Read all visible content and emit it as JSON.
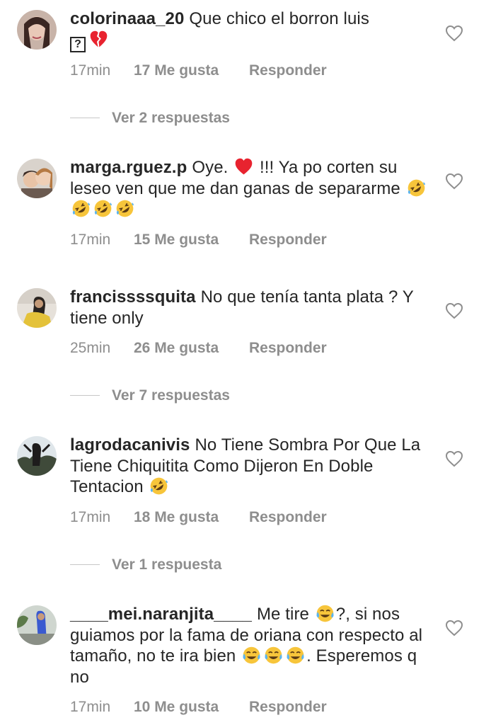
{
  "comments": [
    {
      "username": "colorinaaa_20",
      "text_parts": [
        "Que chico el borron luis",
        "?"
      ],
      "time": "17min",
      "likes": "17 Me gusta",
      "reply": "Responder",
      "replies": "Ver 2 respuestas"
    },
    {
      "username": "marga.rguez.p",
      "text_parts": [
        "Oye. ",
        " !!! Ya po corten su leseo ven que me dan ganas de separarme "
      ],
      "time": "17min",
      "likes": "15 Me gusta",
      "reply": "Responder"
    },
    {
      "username": "francissssquita",
      "text_parts": [
        "No que tenía tanta plata ? Y tiene only"
      ],
      "time": "25min",
      "likes": "26 Me gusta",
      "reply": "Responder",
      "replies": "Ver 7 respuestas"
    },
    {
      "username": "lagrodacanivis",
      "text_parts": [
        "No Tiene Sombra Por Que La Tiene Chiquitita Como Dijeron En Doble Tentacion "
      ],
      "time": "17min",
      "likes": "18 Me gusta",
      "reply": "Responder",
      "replies": "Ver 1 respuesta"
    },
    {
      "username": "____mei.naranjita____",
      "text_parts": [
        "Me tire ",
        "?, si nos guiamos por la fama de oriana con respecto  al tamaño, no te ira bien ",
        ". Esperemos q no"
      ],
      "time": "17min",
      "likes": "10 Me gusta",
      "reply": "Responder"
    }
  ],
  "icons": {
    "heart": "heart-outline-icon",
    "broken_heart": "broken-heart-emoji",
    "red_heart": "red-heart-emoji",
    "rofl": "rolling-on-floor-laughing-emoji",
    "tears_of_joy": "face-with-tears-of-joy-emoji"
  },
  "colors": {
    "text": "#262626",
    "secondary": "#8e8e8e",
    "emoji_yellow": "#f7c53b",
    "heart_red": "#e8232f"
  }
}
